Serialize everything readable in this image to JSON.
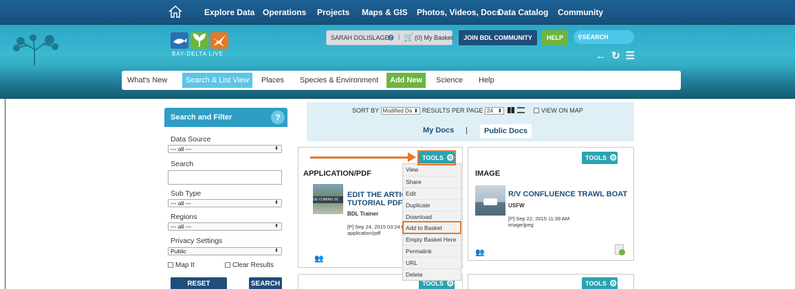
{
  "topnav": {
    "items": [
      "Explore Data",
      "Operations",
      "Projects",
      "Maps & GIS",
      "Photos, Videos, Docs",
      "Data Catalog",
      "Community"
    ]
  },
  "banner": {
    "logo_text": "BAY-DELTA LIVE",
    "user_name": "SARAH DOLISLAGER",
    "basket_label": "(0) My Basket",
    "join_label": "JOIN BDL COMMUNITY",
    "help_label": "HELP",
    "search_label": "SEARCH"
  },
  "subnav": {
    "items": [
      "What's New",
      "Search & List View",
      "Places",
      "Species & Environment",
      "Add New",
      "Science",
      "Help"
    ],
    "active": "Search & List View"
  },
  "filter": {
    "title": "Search and Filter",
    "help_glyph": "?",
    "data_source_label": "Data Source",
    "data_source_value": "--- all ---",
    "search_label": "Search",
    "search_value": "",
    "subtype_label": "Sub Type",
    "subtype_value": "--- all ---",
    "regions_label": "Regions",
    "regions_value": "--- all ---",
    "privacy_label": "Privacy Settings",
    "privacy_value": "Public",
    "map_it_label": "Map It",
    "clear_results_label": "Clear Results",
    "reset_label": "RESET LISTINGS",
    "search_button_label": "SEARCH"
  },
  "sortbar": {
    "sort_by_label": "SORT BY",
    "sort_by_value": "Modified Da",
    "results_per_page_label": "RESULTS PER PAGE",
    "results_per_page_value": "24",
    "view_on_map_label": "VIEW ON MAP",
    "my_docs_label": "My Docs",
    "separator": "|",
    "public_docs_label": "Public Docs"
  },
  "cards": [
    {
      "tools_label": "TOOLS",
      "type": "APPLICATION/PDF",
      "title_line1": "EDIT THE ARTICLE",
      "title_line2": "TUTORIAL PDF",
      "thumb_text": "GE COMING SC",
      "author": "BDL Trainer",
      "date": "[P] Sep 24, 2015 03:24 PM",
      "mime": "application/pdf"
    },
    {
      "tools_label": "TOOLS",
      "type": "IMAGE",
      "title": "R/V CONFLUENCE TRAWL BOAT",
      "author": "USFW",
      "date": "[P] Sep 22, 2015 11:39 AM",
      "mime": "image/jpeg"
    }
  ],
  "bottom_tools": [
    "TOOLS",
    "TOOLS"
  ],
  "context_menu": {
    "items": [
      "View",
      "Share",
      "Edit",
      "Duplicate",
      "Download",
      "Add to Basket",
      "Empty Basket Here",
      "Permalink",
      "URL",
      "Delete"
    ],
    "highlighted": "Add to Basket"
  },
  "colors": {
    "nav_blue": "#1c5a8c",
    "accent_teal": "#2aa3b0",
    "highlight_orange": "#e87722",
    "green": "#6eb43f"
  }
}
